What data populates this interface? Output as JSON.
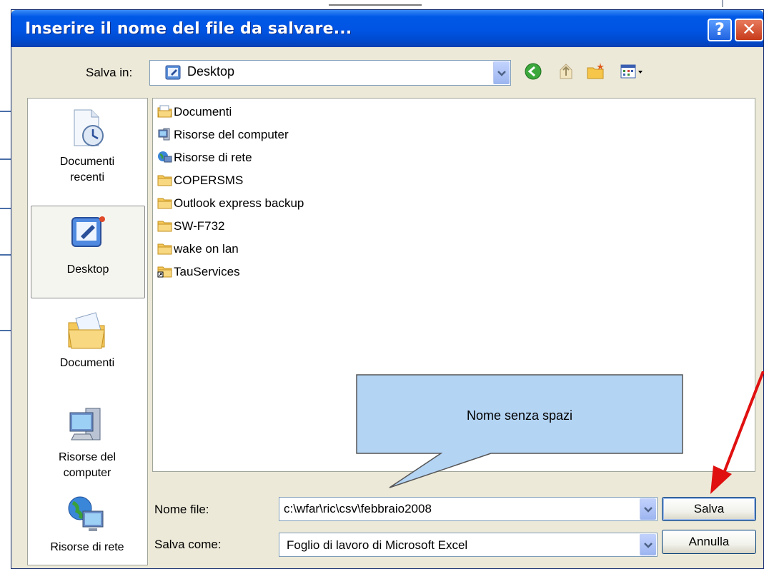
{
  "dialog": {
    "title": "Inserire il nome del file da salvare...",
    "help_button": "?",
    "close_button": "✕"
  },
  "look_in": {
    "label": "Salva in:",
    "value": "Desktop"
  },
  "toolbar": {
    "icons": [
      "back-icon",
      "up-folder-icon",
      "new-folder-icon",
      "views-menu-icon"
    ]
  },
  "places": [
    {
      "label_line1": "Documenti",
      "label_line2": "recenti",
      "icon": "recent-documents-icon"
    },
    {
      "label_line1": "Desktop",
      "label_line2": "",
      "icon": "desktop-icon"
    },
    {
      "label_line1": "Documenti",
      "label_line2": "",
      "icon": "documents-icon"
    },
    {
      "label_line1": "Risorse del",
      "label_line2": "computer",
      "icon": "my-computer-icon"
    },
    {
      "label_line1": "Risorse di rete",
      "label_line2": "",
      "icon": "network-icon"
    }
  ],
  "files": [
    {
      "name": "Documenti",
      "icon": "documents-folder-icon"
    },
    {
      "name": "Risorse del computer",
      "icon": "computer-icon"
    },
    {
      "name": "Risorse di rete",
      "icon": "network-icon"
    },
    {
      "name": "COPERSMS",
      "icon": "folder-icon"
    },
    {
      "name": "Outlook express backup",
      "icon": "folder-icon"
    },
    {
      "name": "SW-F732",
      "icon": "folder-icon"
    },
    {
      "name": "wake on lan",
      "icon": "folder-icon"
    },
    {
      "name": "TauServices",
      "icon": "folder-shortcut-icon"
    }
  ],
  "file_name": {
    "label": "Nome file:",
    "value": "c:\\wfar\\ric\\csv\\febbraio2008"
  },
  "save_as": {
    "label": "Salva come:",
    "value": "Foglio di lavoro di Microsoft Excel"
  },
  "buttons": {
    "save": "Salva",
    "cancel": "Annulla"
  },
  "annotation": {
    "callout_text": "Nome senza spazi",
    "callout_fill": "#b4d4f4",
    "arrow_color": "#e01010"
  }
}
